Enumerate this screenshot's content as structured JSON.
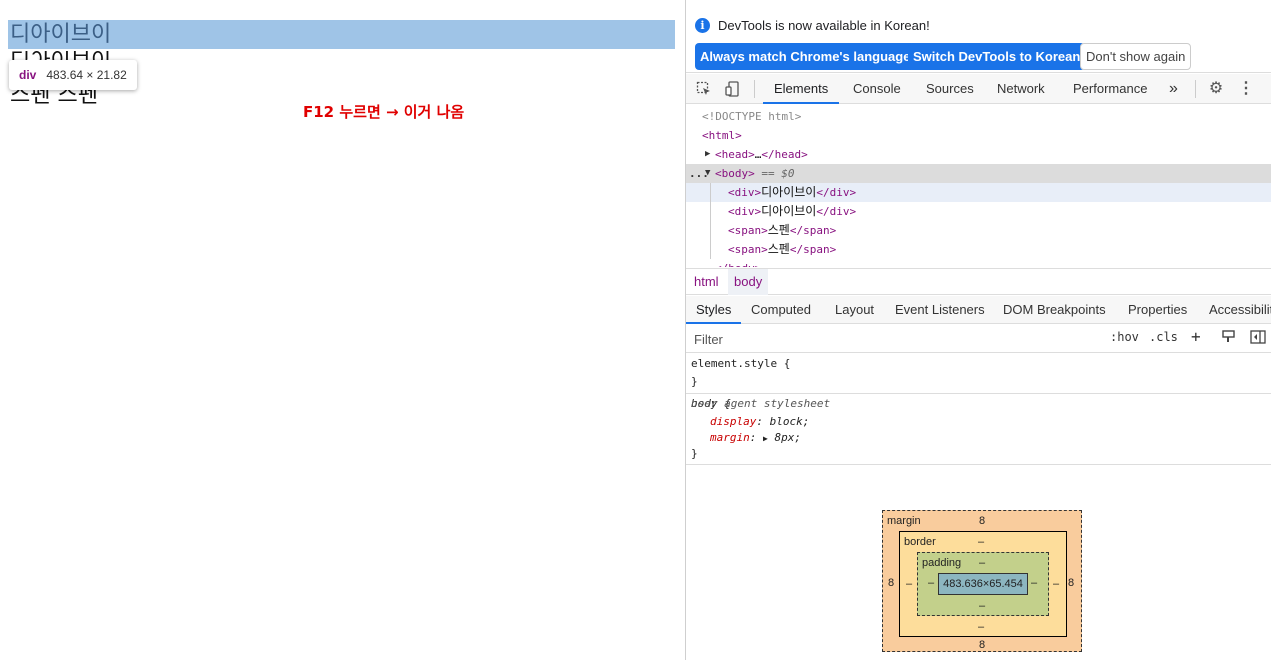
{
  "page": {
    "line1": "디아이브이",
    "line2": "디아이브이",
    "line3": "스펜 스펜",
    "annotation": "F12 누르면 → 이거 나옴",
    "tooltip": {
      "tag": "div",
      "size": "483.64 × 21.82"
    }
  },
  "devtools": {
    "infobar": {
      "icon": "info-icon",
      "message": "DevTools is now available in Korean!",
      "btn_match": "Always match Chrome's language",
      "btn_switch": "Switch DevTools to Korean",
      "btn_dismiss": "Don't show again"
    },
    "tabs": [
      "Elements",
      "Console",
      "Sources",
      "Network",
      "Performance"
    ],
    "active_tab": "Elements",
    "more_tabs": "»",
    "elements": {
      "doctype": "<!DOCTYPE html>",
      "html_open": "<html>",
      "head_open": "<head>",
      "head_ellipsis": "…",
      "head_close": "</head>",
      "body_open": "<body>",
      "body_eq": "== $0",
      "ellipsis": "...",
      "children": [
        {
          "open": "<div>",
          "text": "디아이브이",
          "close": "</div>"
        },
        {
          "open": "<div>",
          "text": "디아이브이",
          "close": "</div>"
        },
        {
          "open": "<span>",
          "text": "스펜",
          "close": "</span>"
        },
        {
          "open": "<span>",
          "text": "스펜",
          "close": "</span>"
        }
      ],
      "body_close": "</body>"
    },
    "breadcrumbs": [
      "html",
      "body"
    ],
    "subtabs": [
      "Styles",
      "Computed",
      "Layout",
      "Event Listeners",
      "DOM Breakpoints",
      "Properties",
      "Accessibility"
    ],
    "filter": {
      "placeholder": "Filter",
      "hov": ":hov",
      "cls": ".cls",
      "plus": "+"
    },
    "styles": {
      "element_style": "element.style {",
      "close_brace": "}",
      "body_selector": "body {",
      "ua_source": "user agent stylesheet",
      "decls": [
        {
          "prop": "display",
          "value": "block;"
        },
        {
          "prop": "margin",
          "value": "8px;"
        }
      ]
    },
    "boxmodel": {
      "margin_label": "margin",
      "margin_top": "8",
      "margin_bottom": "8",
      "margin_left": "8",
      "margin_right": "8",
      "border_label": "border",
      "border_dash": "–",
      "padding_label": "padding",
      "padding_dash": "–",
      "content": "483.636×65.454"
    }
  }
}
